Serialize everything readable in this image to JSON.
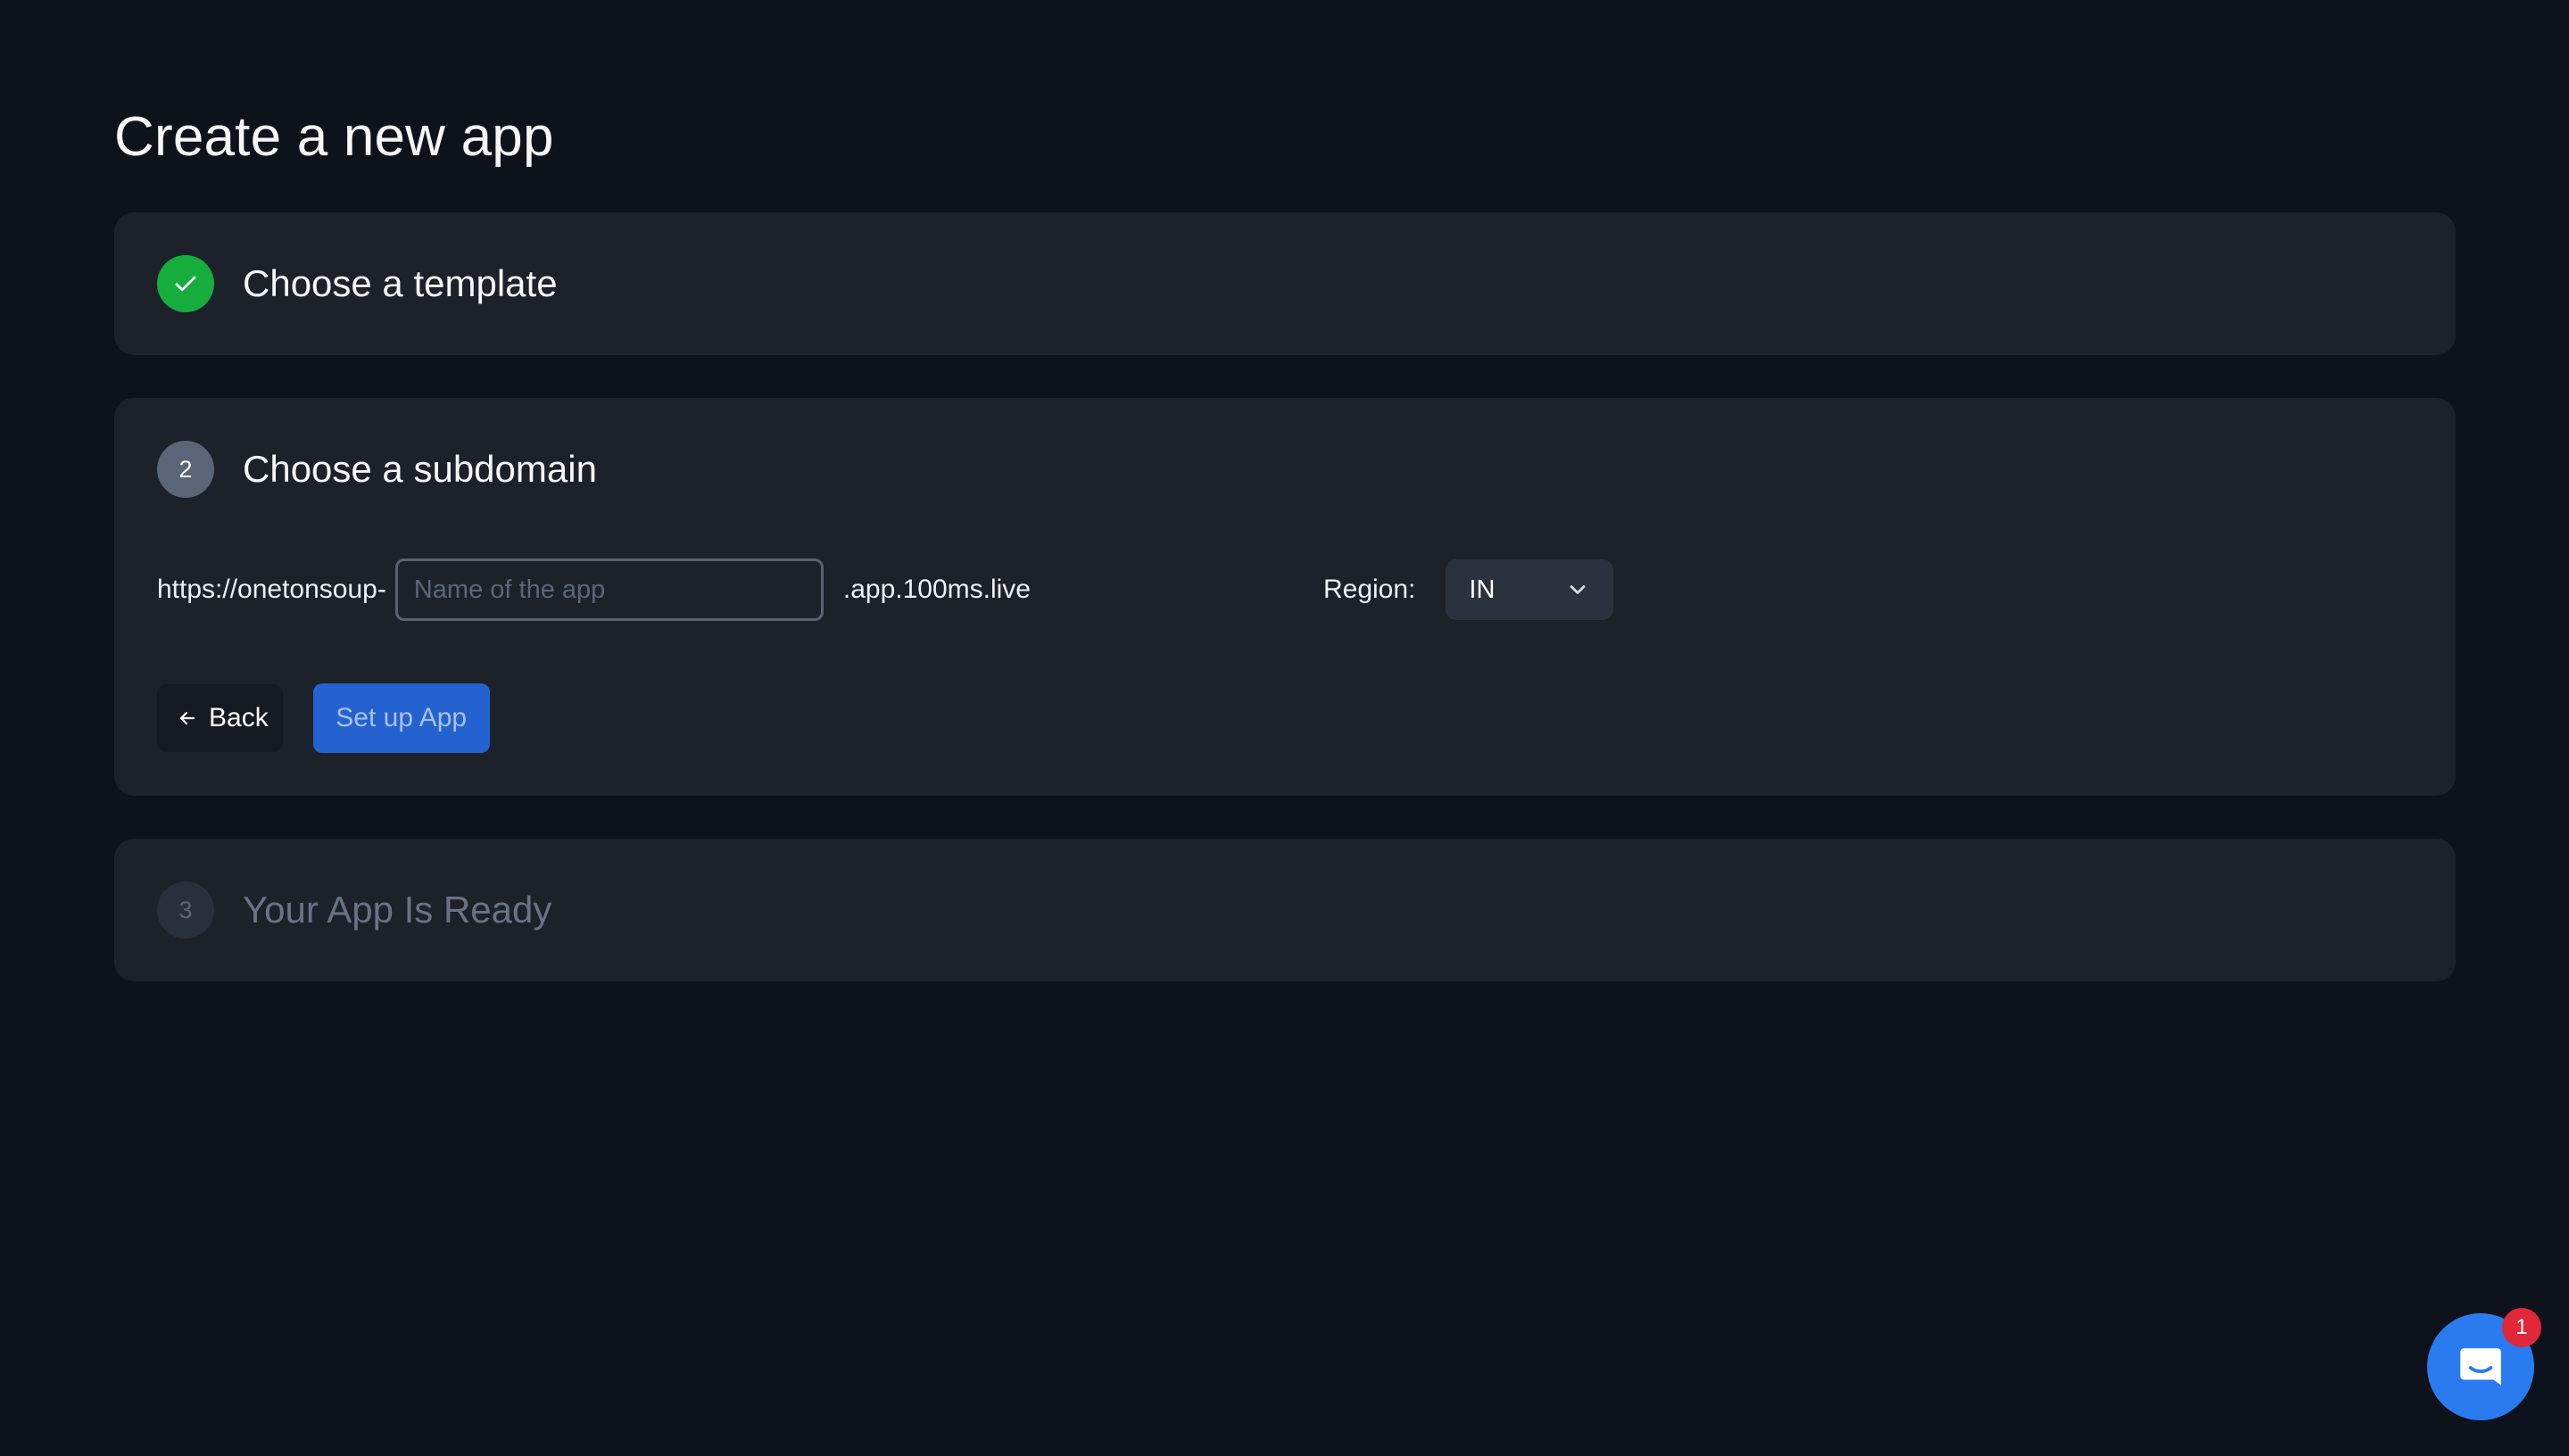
{
  "page": {
    "title": "Create a new app"
  },
  "steps": [
    {
      "number": "",
      "title": "Choose a template",
      "status": "done"
    },
    {
      "number": "2",
      "title": "Choose a subdomain",
      "status": "active"
    },
    {
      "number": "3",
      "title": "Your App Is Ready",
      "status": "pending"
    }
  ],
  "subdomain": {
    "prefix": "https://onetonsoup-",
    "input_value": "",
    "input_placeholder": "Name of the app",
    "suffix": ".app.100ms.live",
    "region_label": "Region:",
    "region_value": "IN"
  },
  "actions": {
    "back_label": "Back",
    "setup_label": "Set up App"
  },
  "chat": {
    "unread_count": "1"
  },
  "icons": {
    "step1": "check-icon",
    "region": "chevron-down-icon",
    "back": "arrow-left-icon",
    "chat": "chat-bubble-icon"
  },
  "colors": {
    "background": "#0e121b",
    "card": "#1c212a",
    "success": "#17ad3d",
    "primary": "#2462cf",
    "chat": "#2a7bf0",
    "badge": "#e0283a"
  }
}
